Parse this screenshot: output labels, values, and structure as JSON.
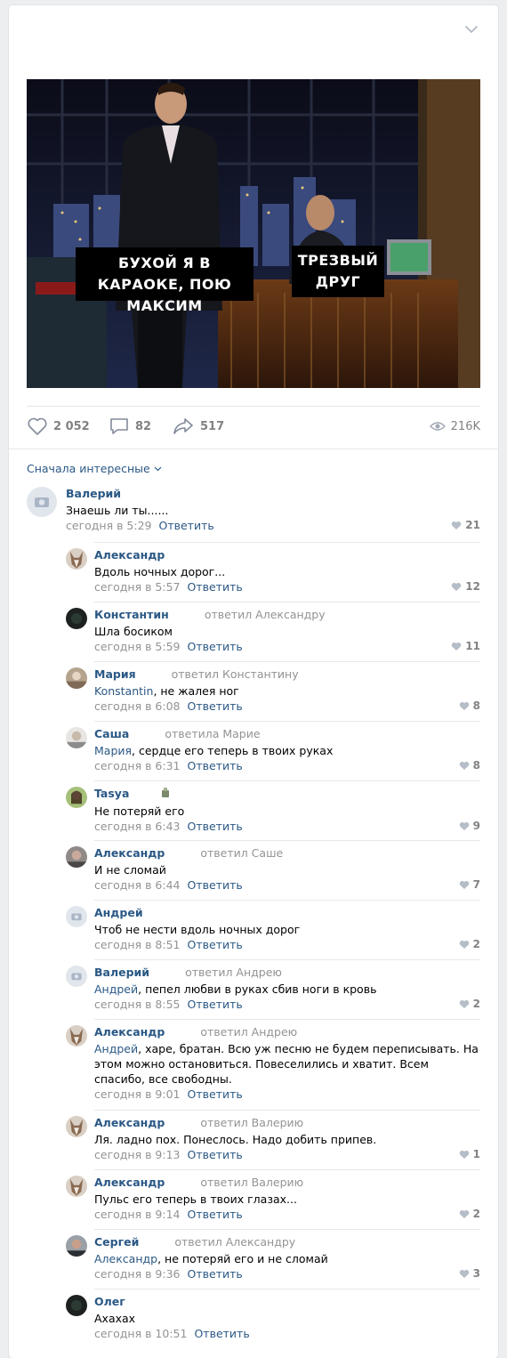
{
  "post": {
    "caption_left": "Бухой я в караоке, пою Максим",
    "caption_right": "Трезвый друг",
    "likes": "2 052",
    "comments": "82",
    "shares": "517",
    "views": "216K"
  },
  "comments_sort": "Сначала интересные",
  "reply_label": "Ответить",
  "comments": [
    {
      "author": "Валерий",
      "replied": "",
      "mention": "",
      "text": "Знаешь ли ты......",
      "time": "сегодня в 5:29",
      "likes": "21",
      "avatar": "camera-placeholder"
    },
    {
      "author": "Александр",
      "replied": "",
      "mention": "",
      "text": "Вдоль ночных дорог...",
      "time": "сегодня в 5:57",
      "likes": "12",
      "avatar": "wolf"
    },
    {
      "author": "Константин",
      "replied": "ответил Александру",
      "mention": "",
      "text": "Шла босиком",
      "time": "сегодня в 5:59",
      "likes": "11",
      "avatar": "dark"
    },
    {
      "author": "Мария",
      "replied": "ответил Константину",
      "mention": "Konstantin",
      "text": ", не жалея ног",
      "time": "сегодня в 6:08",
      "likes": "8",
      "avatar": "photo-beige"
    },
    {
      "author": "Саша",
      "replied": "ответила Марие",
      "mention": "Мария",
      "text": ", сердце его теперь в твоих руках",
      "time": "сегодня в 6:31",
      "likes": "8",
      "avatar": "photo-light"
    },
    {
      "author": "Tasya",
      "replied": "",
      "mention": "",
      "text": "Не потеряй его",
      "time": "сегодня в 6:43",
      "likes": "9",
      "avatar": "photo-green"
    },
    {
      "author": "Александр",
      "replied": "ответил Саше",
      "mention": "",
      "text": "И не сломай",
      "time": "сегодня в 6:44",
      "likes": "7",
      "avatar": "photo-grey"
    },
    {
      "author": "Андрей",
      "replied": "",
      "mention": "",
      "text": "Чтоб не нести вдоль ночных дорог",
      "time": "сегодня в 8:51",
      "likes": "2",
      "avatar": "camera-placeholder"
    },
    {
      "author": "Валерий",
      "replied": "ответил Андрею",
      "mention": "Андрей",
      "text": ", пепел любви в руках сбив ноги в кровь",
      "time": "сегодня в 8:55",
      "likes": "2",
      "avatar": "camera-placeholder"
    },
    {
      "author": "Александр",
      "replied": "ответил Андрею",
      "mention": "Андрей",
      "text": ", харе, братан. Всю уж песню не будем переписывать. На этом можно остановиться. Повеселились и хватит. Всем спасибо, все свободны.",
      "time": "сегодня в 9:01",
      "likes": "",
      "avatar": "wolf"
    },
    {
      "author": "Александр",
      "replied": "ответил Валерию",
      "mention": "",
      "text": "Ля. ладно пох. Понеслось. Надо добить припев.",
      "time": "сегодня в 9:13",
      "likes": "1",
      "avatar": "wolf"
    },
    {
      "author": "Александр",
      "replied": "ответил Валерию",
      "mention": "",
      "text": "Пульс его теперь в твоих глазах...",
      "time": "сегодня в 9:14",
      "likes": "2",
      "avatar": "wolf"
    },
    {
      "author": "Сергей",
      "replied": "ответил Александру",
      "mention": "Александр",
      "text": ", не потеряй его и не сломай",
      "time": "сегодня в 9:36",
      "likes": "3",
      "avatar": "photo-man"
    },
    {
      "author": "Олег",
      "replied": "",
      "mention": "",
      "text": "Ахахах",
      "time": "сегодня в 10:51",
      "likes": "",
      "avatar": "dark-round"
    }
  ]
}
